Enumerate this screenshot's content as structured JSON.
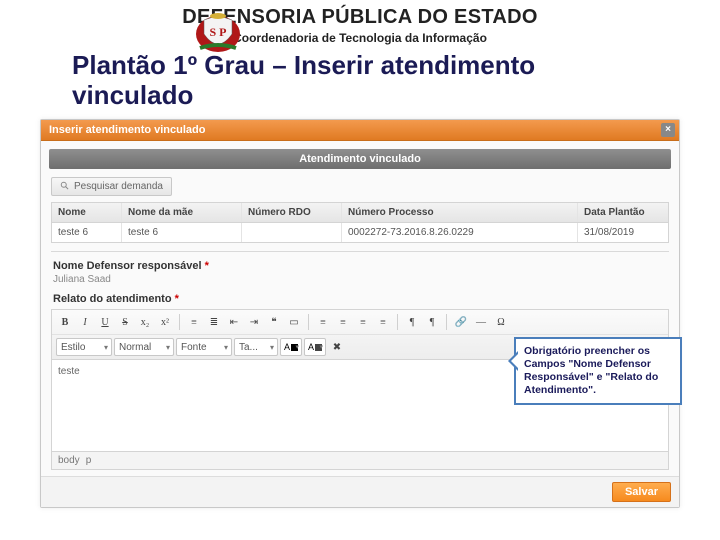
{
  "header": {
    "org": "DEFENSORIA PÚBLICA DO ESTADO",
    "dept": "Coordenadoria de Tecnologia da Informação"
  },
  "title_line1": "Plantão 1º Grau – Inserir atendimento",
  "title_line2": "vinculado",
  "modal": {
    "title": "Inserir atendimento vinculado",
    "close": "×",
    "section": "Atendimento vinculado",
    "search_label": "Pesquisar demanda"
  },
  "grid": {
    "headers": {
      "nome": "Nome",
      "mae": "Nome da mãe",
      "rdo": "Número RDO",
      "proc": "Número Processo",
      "data": "Data Plantão"
    },
    "row": {
      "nome": "teste 6",
      "mae": "teste 6",
      "rdo": "",
      "proc": "0002272-73.2016.8.26.0229",
      "data": "31/08/2019"
    }
  },
  "fields": {
    "defensor_label": "Nome Defensor responsável",
    "defensor_value": "Juliana Saad",
    "relato_label": "Relato do atendimento",
    "req": "*"
  },
  "editor": {
    "btn_bold": "B",
    "btn_italic": "I",
    "btn_underline": "U",
    "btn_strike": "S",
    "btn_sub": "x₂",
    "btn_sup": "x²",
    "btn_ol": "≡",
    "btn_ul": "≣",
    "btn_outdent": "⇤",
    "btn_indent": "⇥",
    "btn_quote": "❝",
    "btn_div": "▭",
    "btn_left": "≡",
    "btn_center": "≡",
    "btn_right": "≡",
    "btn_just": "≡",
    "btn_ltr": "¶",
    "btn_rtl": "¶",
    "btn_link": "🔗",
    "btn_hr": "—",
    "btn_spchar": "Ω",
    "combo_style": "Estilo",
    "combo_format": "Normal",
    "combo_font": "Fonte",
    "combo_size": "Ta...",
    "color_text": "A",
    "btn_clear": "✖",
    "body_text": "teste",
    "footer_body": "body",
    "footer_p": "p"
  },
  "save": "Salvar",
  "callout": "Obrigatório preencher os Campos \"Nome Defensor Responsável\" e \"Relato do Atendimento\"."
}
